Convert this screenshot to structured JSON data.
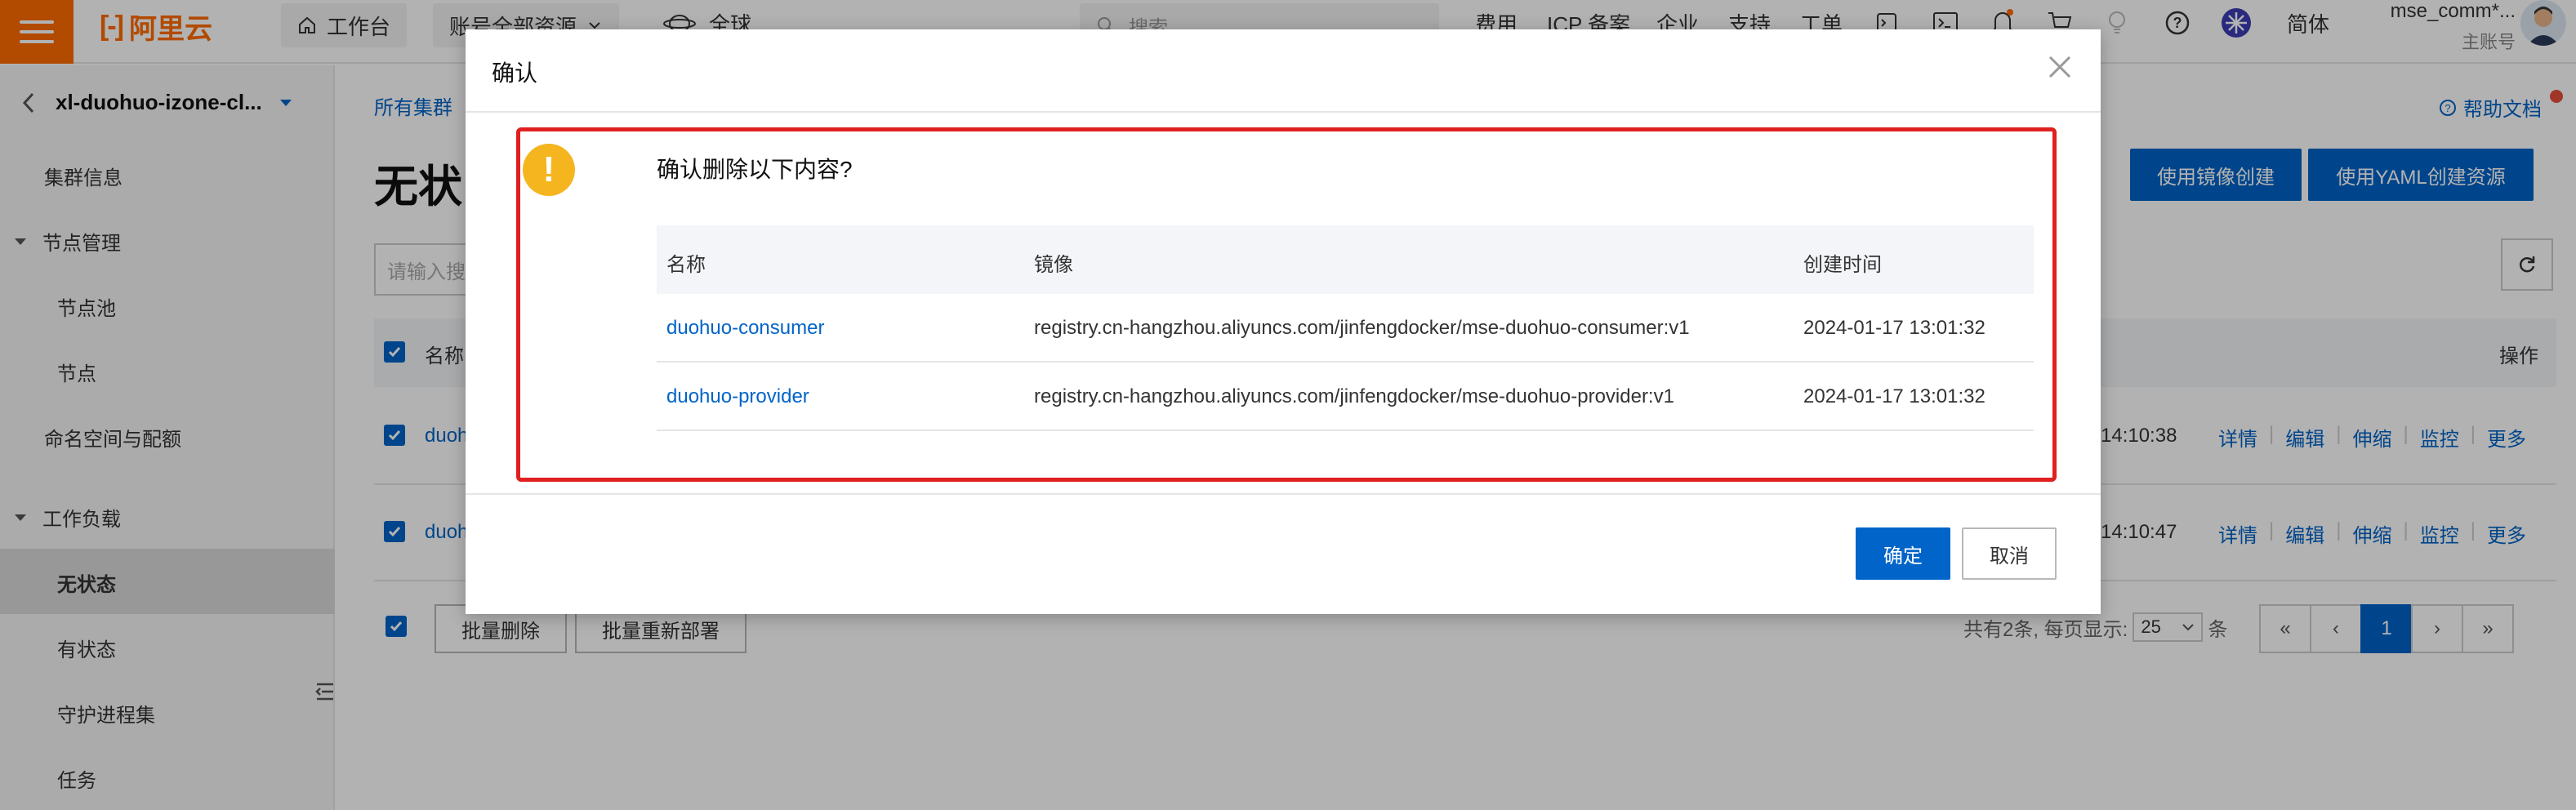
{
  "topbar": {
    "logo_text": "阿里云",
    "workbench": "工作台",
    "resource_scope": "账号全部资源",
    "region": "全球",
    "search_placeholder": "搜索...",
    "nav": [
      "费用",
      "ICP 备案",
      "企业",
      "支持",
      "工单"
    ],
    "lang": "简体",
    "user_name": "mse_comm*...",
    "user_sub": "主账号"
  },
  "sidebar": {
    "cluster_name": "xl-duohuo-izone-cl...",
    "cluster_info": "集群信息",
    "node_mgmt": "节点管理",
    "node_pool": "节点池",
    "nodes": "节点",
    "namespace_quota": "命名空间与配额",
    "workload": "工作负载",
    "stateless": "无状态",
    "stateful": "有状态",
    "daemonset": "守护进程集",
    "jobs": "任务"
  },
  "main": {
    "breadcrumb": "所有集群",
    "title": "无状",
    "help_doc": "帮助文档",
    "btn_create_image": "使用镜像创建",
    "btn_create_yaml": "使用YAML创建资源",
    "search_placeholder": "请输入搜",
    "col_name": "名称",
    "col_actions": "操作",
    "rows": [
      {
        "name": "duoh",
        "time": "14:10:38",
        "actions": [
          "详情",
          "编辑",
          "伸缩",
          "监控",
          "更多"
        ]
      },
      {
        "name": "duoh",
        "time": "14:10:47",
        "actions": [
          "详情",
          "编辑",
          "伸缩",
          "监控",
          "更多"
        ]
      }
    ],
    "btn_batch_delete": "批量删除",
    "btn_batch_redeploy": "批量重新部署",
    "pager_total": "共有2条, 每页显示:",
    "pager_size": "25",
    "pager_unit": "条",
    "pager_current": "1"
  },
  "modal": {
    "title": "确认",
    "question": "确认删除以下内容?",
    "columns": [
      "名称",
      "镜像",
      "创建时间"
    ],
    "rows": [
      {
        "name": "duohuo-consumer",
        "image": "registry.cn-hangzhou.aliyuncs.com/jinfengdocker/mse-duohuo-consumer:v1",
        "created": "2024-01-17 13:01:32"
      },
      {
        "name": "duohuo-provider",
        "image": "registry.cn-hangzhou.aliyuncs.com/jinfengdocker/mse-duohuo-provider:v1",
        "created": "2024-01-17 13:01:32"
      }
    ],
    "ok": "确定",
    "cancel": "取消"
  },
  "colors": {
    "brand": "#ff6a00",
    "primary": "#0064c8",
    "highlight": "#e02020",
    "warning": "#f5b51f"
  }
}
